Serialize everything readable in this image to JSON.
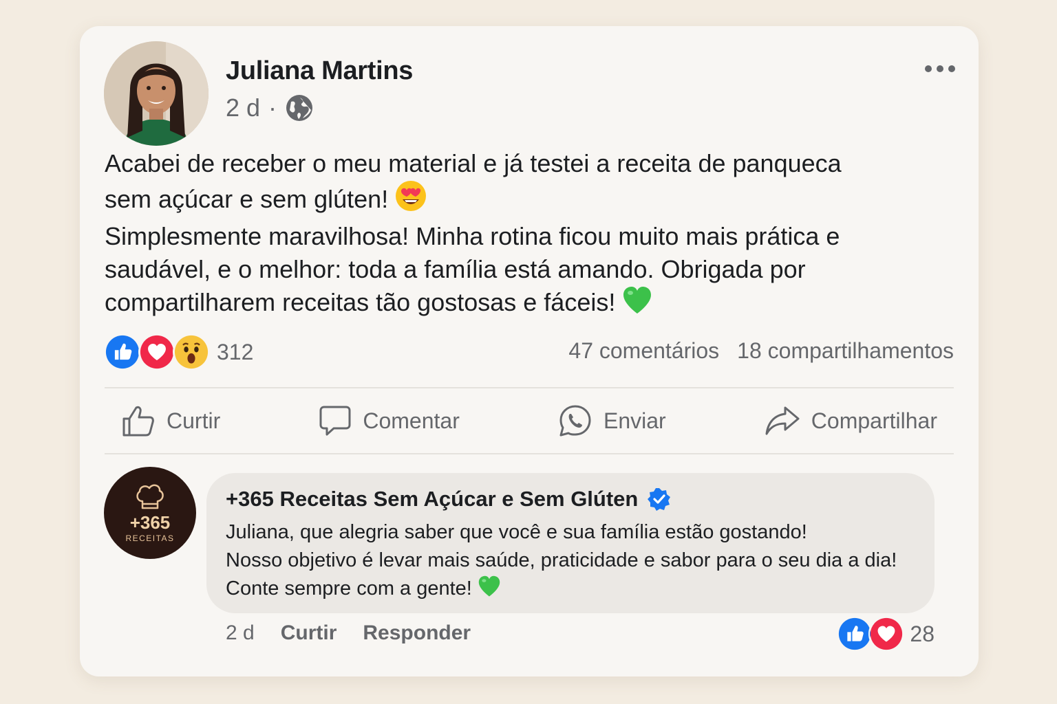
{
  "post": {
    "author": "Juliana Martins",
    "time": "2 d",
    "separator": "·",
    "text_lines": [
      "Acabei de receber o meu material e já testei a receita de panqueca",
      "sem açúcar e sem glúten!",
      "Simplesmente maravilhosa! Minha rotina ficou muito mais prática e",
      "saudável, e o melhor: toda a família está amando. Obrigada por",
      "compartilharem receitas tão gostosas e fáceis!"
    ],
    "reaction_count": "312",
    "comments": "47 comentários",
    "shares": "18 compartilhamentos"
  },
  "actions": {
    "like": "Curtir",
    "comment": "Comentar",
    "send": "Enviar",
    "share": "Compartilhar"
  },
  "reply": {
    "page_name": "+365 Receitas Sem Açúcar e Sem Glúten",
    "avatar_number": "+365",
    "avatar_label": "RECEITAS",
    "text_lines": [
      "Juliana, que alegria saber que você e sua família estão gostando!",
      "Nosso objetivo é levar mais saúde, praticidade e sabor para o seu dia a dia!",
      "Conte sempre com a gente!"
    ],
    "time": "2 d",
    "like": "Curtir",
    "reply_label": "Responder",
    "reaction_count": "28"
  },
  "icons": {
    "globe": "globe-icon",
    "more": "more-options-icon",
    "like": "thumbs-up-icon",
    "comment": "speech-bubble-icon",
    "send": "whatsapp-icon",
    "share": "share-arrow-icon",
    "verified": "verified-badge-icon",
    "chef": "chef-hat-icon"
  },
  "colors": {
    "like_blue": "#1877f2",
    "love_red": "#f02849",
    "wow_yellow": "#f7c33b",
    "heart_green": "#3cc14a",
    "verified_blue": "#1877f2"
  }
}
